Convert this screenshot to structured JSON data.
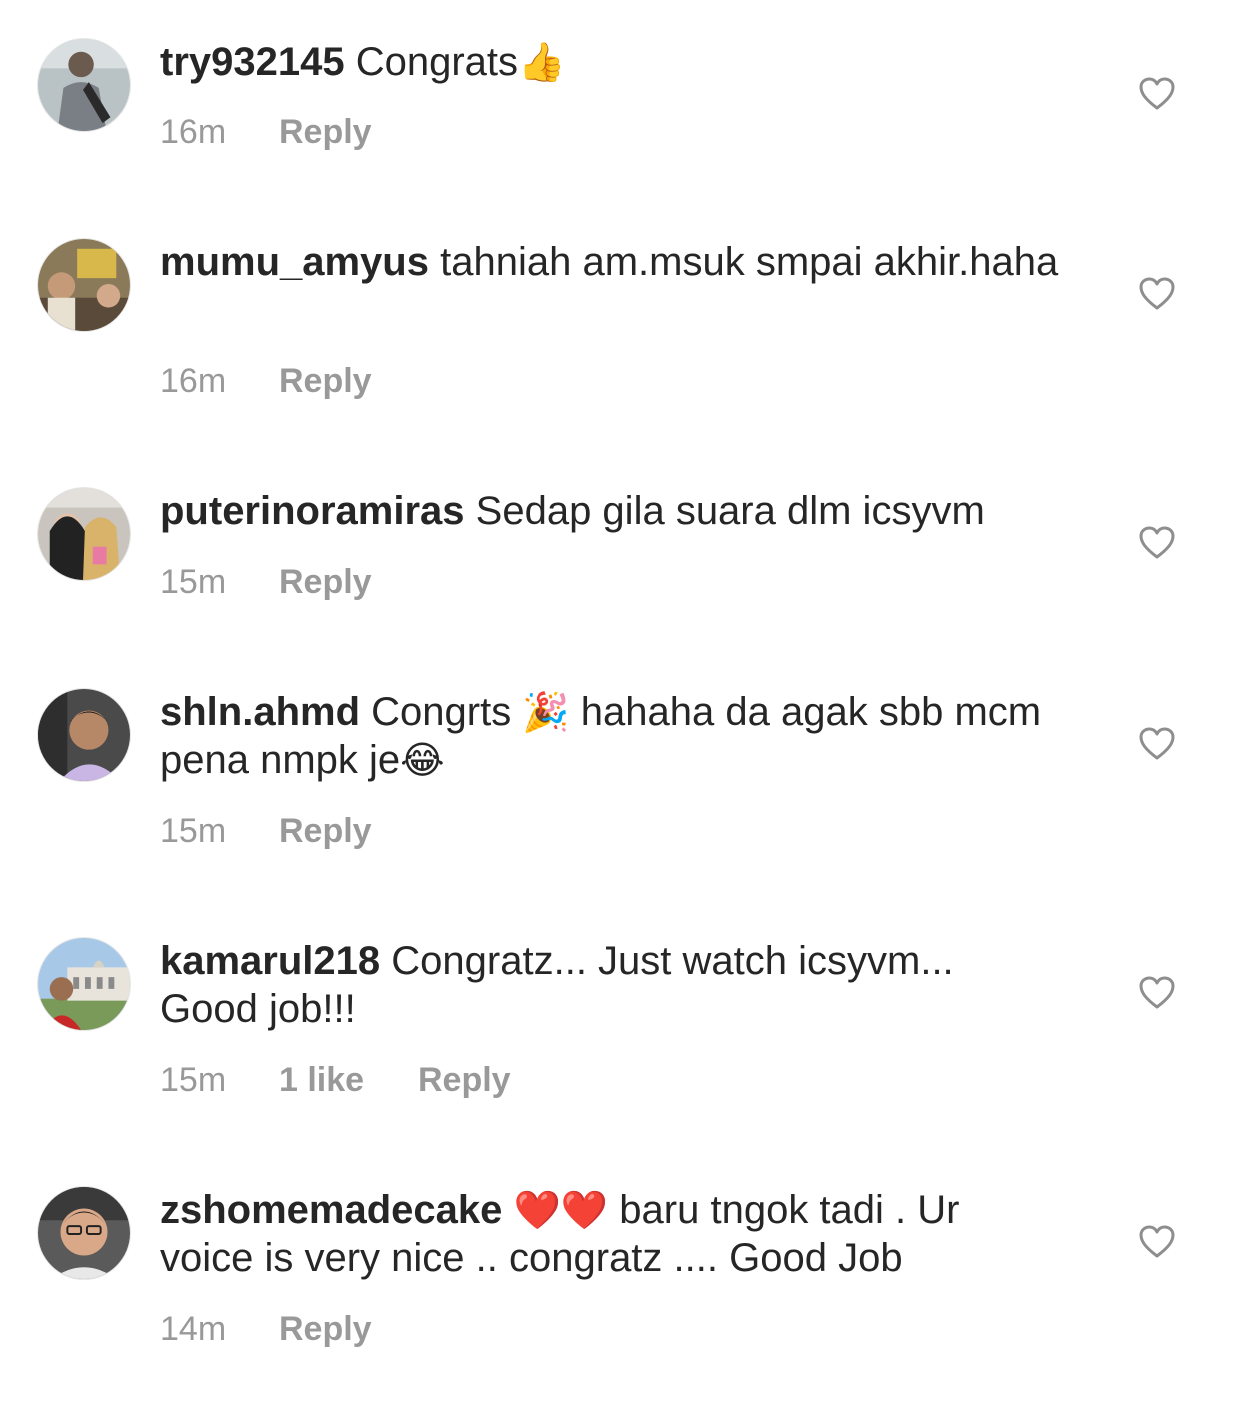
{
  "comments": [
    {
      "username": "try932145",
      "text": "Congrats",
      "emoji_after": "👍",
      "time": "16m",
      "reply": "Reply"
    },
    {
      "username": "mumu_amyus",
      "text": "tahniah am.msuk smpai akhir.haha",
      "time": "16m",
      "reply": "Reply"
    },
    {
      "username": "puterinoramiras",
      "text": "Sedap gila suara dlm icsyvm",
      "time": "15m",
      "reply": "Reply"
    },
    {
      "username": "shln.ahmd",
      "text_before": "Congrts",
      "emoji_mid": "🎉",
      "text_after": "hahaha da agak sbb mcm pena nmpk je",
      "emoji_end": "😂",
      "time": "15m",
      "reply": "Reply"
    },
    {
      "username": "kamarul218",
      "text": "Congratz... Just watch icsyvm... Good job!!!",
      "time": "15m",
      "likes": "1 like",
      "reply": "Reply"
    },
    {
      "username": "zshomemadecake",
      "emoji_start": "❤️❤️",
      "text": "baru tngok tadi . Ur voice is very nice .. congratz .... Good Job",
      "time": "14m",
      "reply": "Reply"
    }
  ],
  "icons": {
    "like": "heart-outline-icon",
    "avatar": "profile-photo"
  },
  "colors": {
    "text": "#262626",
    "meta": "#999999",
    "icon_stroke": "#8e8e8e"
  }
}
